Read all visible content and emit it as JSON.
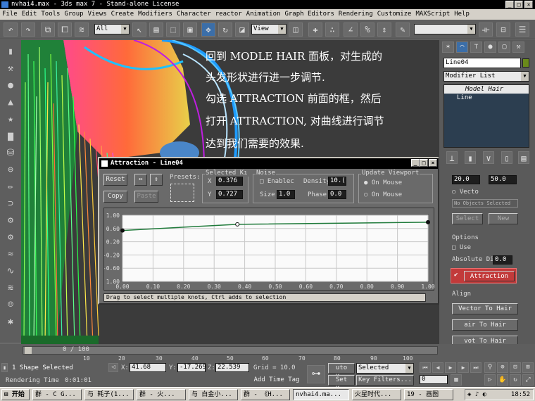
{
  "window": {
    "title": "nvhai4.max - 3ds max 7 - Stand-alone License"
  },
  "menu": [
    "File",
    "Edit",
    "Tools",
    "Group",
    "Views",
    "Create",
    "Modifiers",
    "Character",
    "reactor",
    "Animation",
    "Graph Editors",
    "Rendering",
    "Customize",
    "MAXScript",
    "Help"
  ],
  "toolbar": {
    "filter_value": "All",
    "coord_value": "View"
  },
  "viewport": {
    "text_lines": [
      "回到 MODLE HAIR 面板，对生成的",
      "头发形状进行进一步调节.",
      "勾选 ATTRACTION 前面的框，然后",
      "打开 ATTRACTION, 对曲线进行调节",
      "达到我们需要的效果."
    ]
  },
  "command_panel": {
    "object_name": "Line04",
    "modifier_list": "Modifier List",
    "stack": [
      "Model Hair",
      "Line"
    ],
    "spin1": "20.0",
    "spin2": "50.0",
    "vector_label": "Vecto",
    "no_objects": "No Objects Selected",
    "select_btn": "Select",
    "new_btn": "New",
    "options_label": "Options",
    "use_label": "Use",
    "absolute_label": "Absolute Dir",
    "absolute_value": "0.0",
    "attraction_btn": "Attraction",
    "align_label": "Align",
    "vector_to_hair": "Vector To Hair",
    "hair_coords": "air To Hair Coordsy",
    "root_coords": "vot To Hair Coords"
  },
  "dialog": {
    "title": "Attraction - Line04",
    "reset": "Reset",
    "copy": "Copy",
    "paste": "Paste",
    "presets": "Presets:",
    "selected_label": "Selected Kı",
    "x_label": "X",
    "x_value": "0.376",
    "y_label": "Y",
    "y_value": "0.727",
    "noise_label": "Noise",
    "enable_label": "Enablec",
    "density_label": "Density",
    "density_value": "10.(",
    "size_label": "Size",
    "size_value": "1.0",
    "phase_label": "Phase",
    "phase_value": "0.0",
    "update_label": "Update Viewport",
    "on_mouse1": "On Mouse",
    "on_mouse2": "On Mouse",
    "status": "Drag to select multiple knots, Ctrl adds to selection"
  },
  "chart_data": {
    "type": "line",
    "y_ticks": [
      "1.00",
      "0.60",
      "0.20",
      "-0.20",
      "-0.60",
      "1.00"
    ],
    "x_ticks": [
      "0.00",
      "0.10",
      "0.20",
      "0.30",
      "0.40",
      "0.50",
      "0.60",
      "0.70",
      "0.80",
      "0.90",
      "1.00"
    ],
    "xlim": [
      0,
      1
    ],
    "ylim": [
      -1,
      1
    ],
    "x": [
      0.0,
      0.376,
      1.0
    ],
    "y": [
      0.54,
      0.727,
      0.79
    ]
  },
  "timeline": {
    "frame_label": "0 / 100",
    "ticks": [
      "10",
      "20",
      "30",
      "40",
      "50",
      "60",
      "70",
      "80",
      "90",
      "100"
    ]
  },
  "status": {
    "selection": "1 Shape Selected",
    "x_label": "X:",
    "x_value": "41.68",
    "y_label": "Y:",
    "y_value": "-17.269",
    "z_label": "Z:",
    "z_value": "22.539",
    "grid": "Grid = 10.0",
    "render_time_label": "Rendering Time",
    "render_time": "0:01:01",
    "add_time_tag": "Add Time Tag",
    "auto_key": "uto Key",
    "selected": "Selected",
    "set_key": "Set Key",
    "key_filters": "Key Filters...",
    "frame": "0"
  },
  "taskbar": {
    "start": "开始",
    "items": [
      "群 - C G...",
      "与 耗子(1...",
      "群 - 火...",
      "与 白金小...",
      "群 - 《H...",
      "nvhai4.ma...",
      "火星时代...",
      "19 - 画图"
    ],
    "clock": "18:52"
  }
}
